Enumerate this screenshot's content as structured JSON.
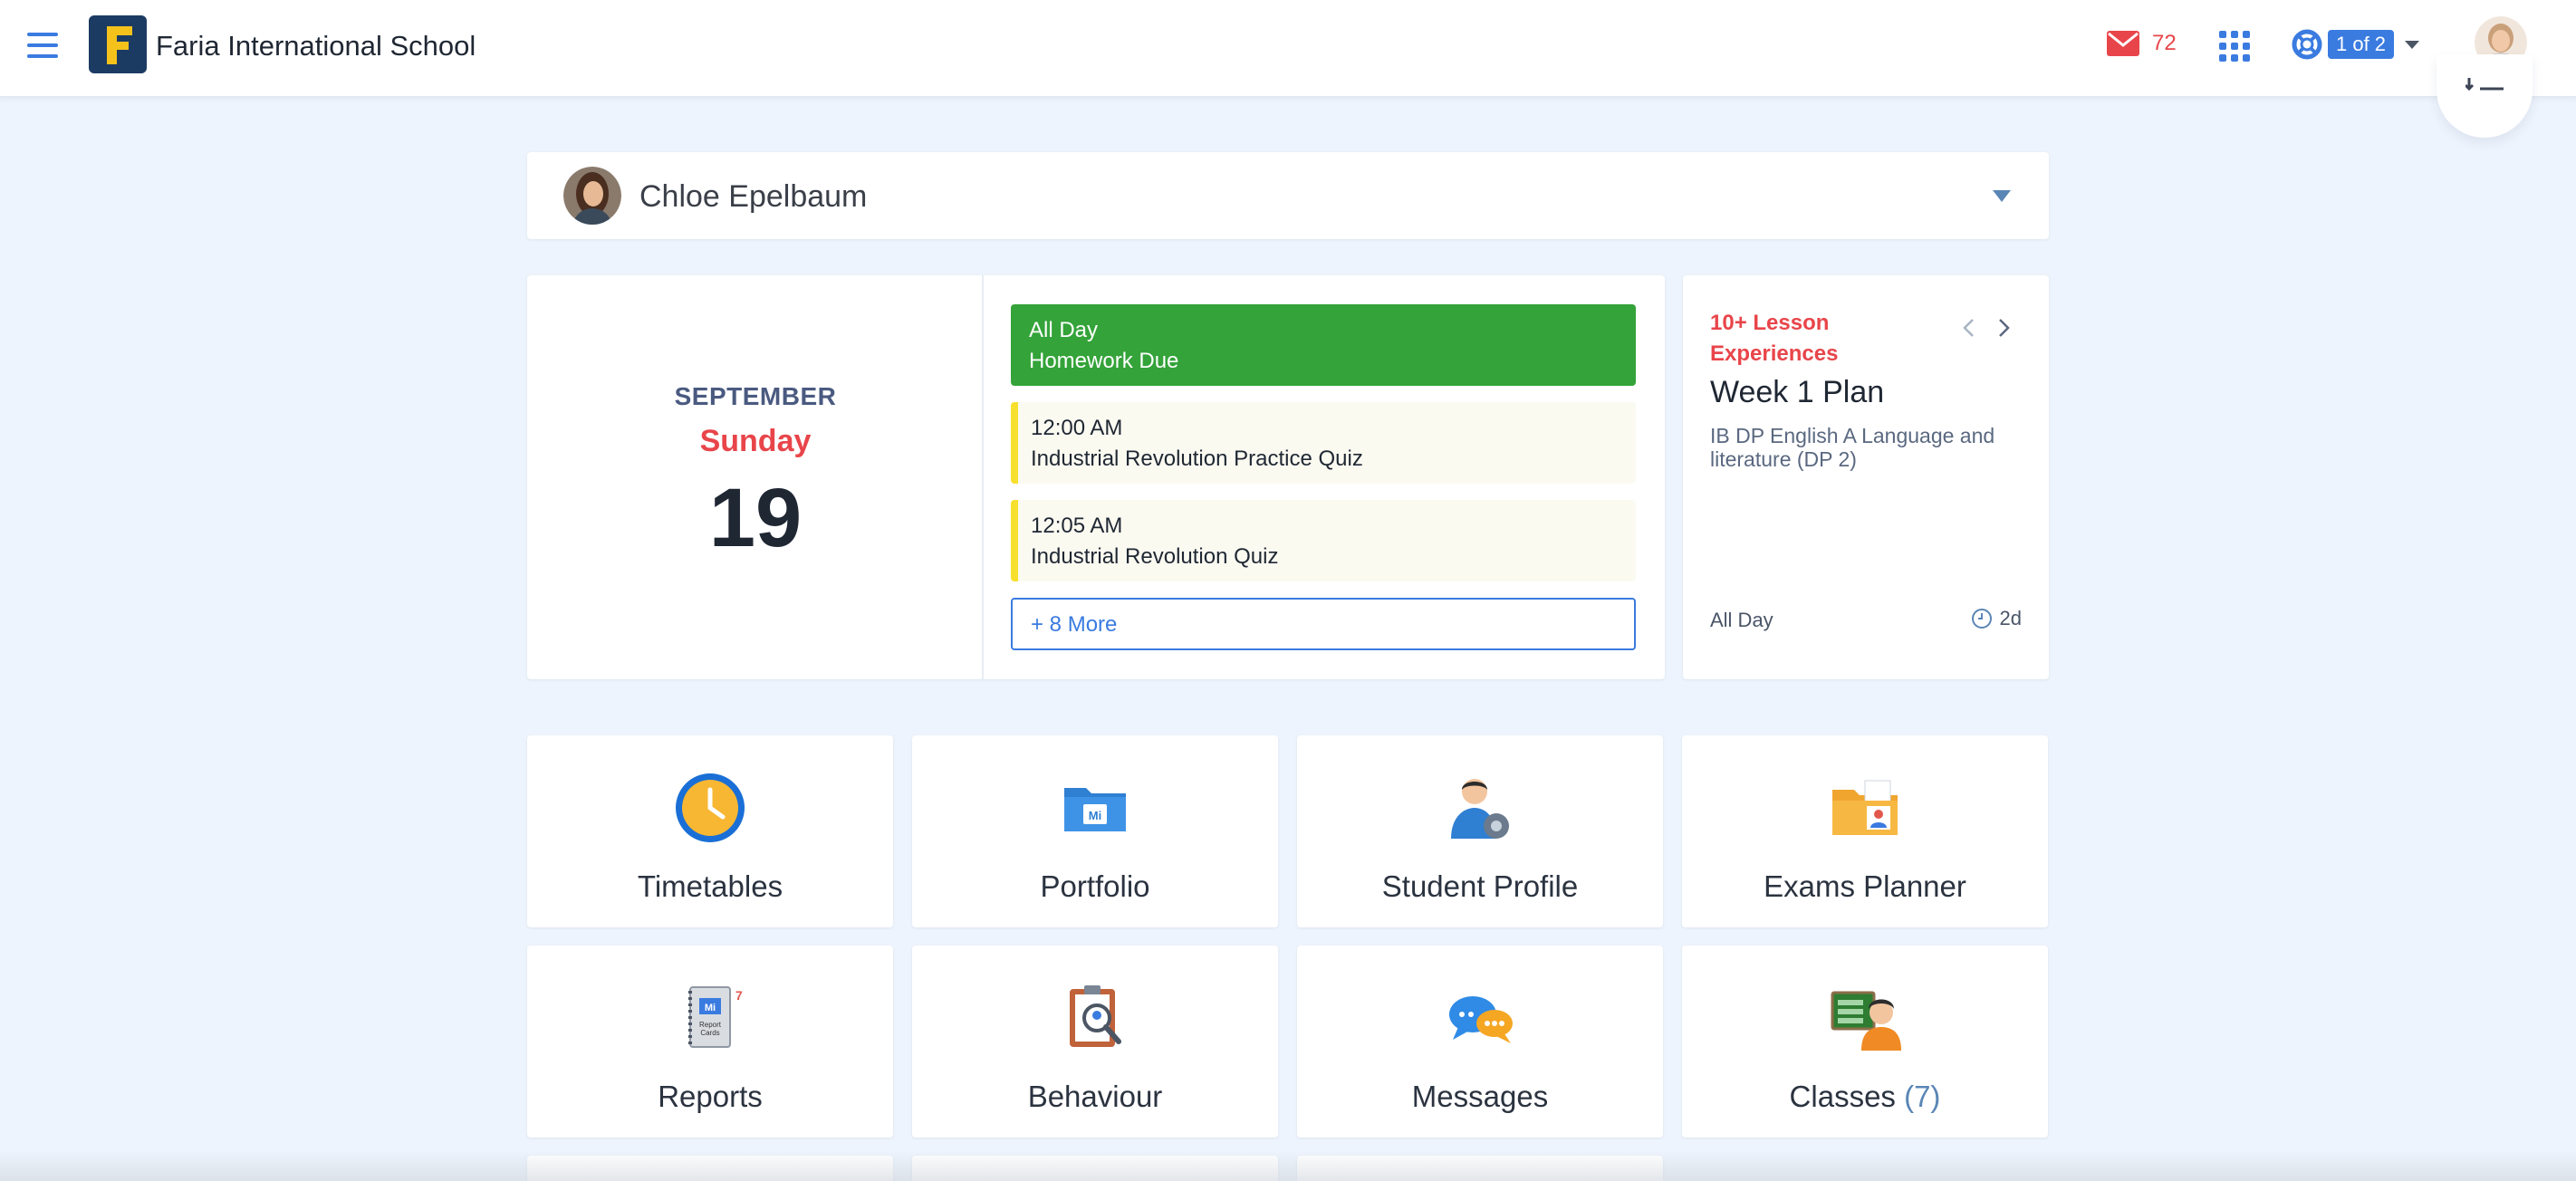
{
  "header": {
    "school_name": "Faria International School",
    "mail_count": "72",
    "help_badge": "1 of 2"
  },
  "student": {
    "name": "Chloe Epelbaum"
  },
  "calendar": {
    "month": "SEPTEMBER",
    "weekday": "Sunday",
    "day": "19",
    "events": [
      {
        "time": "All Day",
        "title": "Homework Due",
        "style": "green"
      },
      {
        "time": "12:00 AM",
        "title": "Industrial Revolution Practice Quiz",
        "style": "yellow"
      },
      {
        "time": "12:05 AM",
        "title": "Industrial Revolution Quiz",
        "style": "yellow"
      }
    ],
    "more_label": "+ 8 More"
  },
  "lesson": {
    "tag": "10+ Lesson Experiences",
    "title": "Week 1 Plan",
    "subtitle": "IB DP English A Language and literature (DP 2)",
    "time": "All Day",
    "duration": "2d"
  },
  "tiles": [
    {
      "label": "Timetables",
      "icon": "clock-icon"
    },
    {
      "label": "Portfolio",
      "icon": "folder-icon"
    },
    {
      "label": "Student Profile",
      "icon": "student-profile-icon"
    },
    {
      "label": "Exams Planner",
      "icon": "exams-folder-icon"
    },
    {
      "label": "Reports",
      "icon": "report-cards-icon"
    },
    {
      "label": "Behaviour",
      "icon": "behaviour-clipboard-icon"
    },
    {
      "label": "Messages",
      "icon": "chat-bubbles-icon"
    },
    {
      "label": "Classes",
      "count": "(7)",
      "icon": "classes-board-icon"
    }
  ],
  "colors": {
    "accent": "#3a7be0",
    "alert": "#e8454a",
    "allday_event": "#34a339",
    "quiz_marker": "#f7e02d",
    "page_bg": "#eef4fd"
  }
}
